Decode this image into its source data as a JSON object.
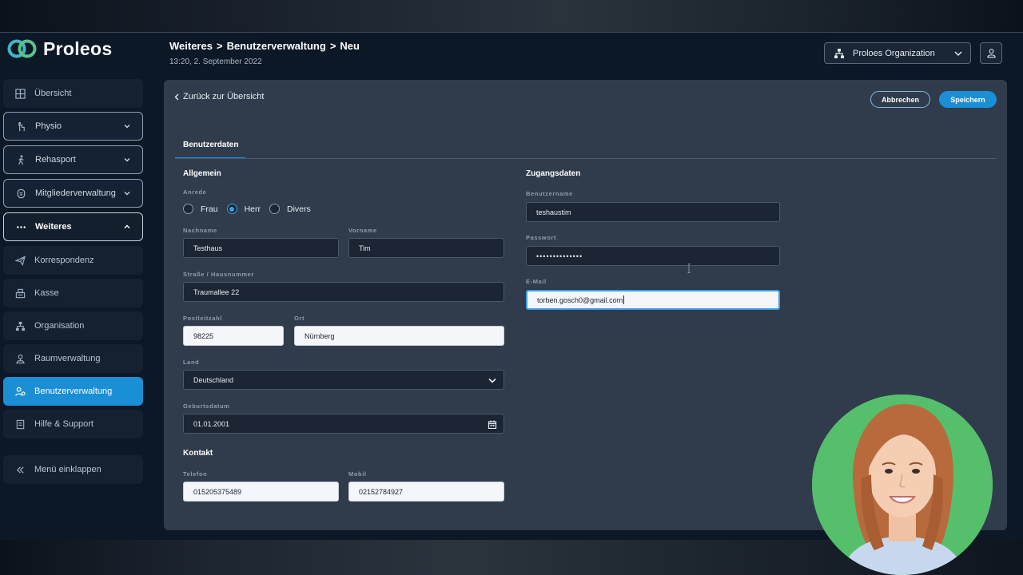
{
  "app": {
    "logo_text": "Proleos"
  },
  "header": {
    "breadcrumb": [
      "Weiteres",
      "Benutzerverwaltung",
      "Neu"
    ],
    "timestamp": "13:20, 2. September 2022",
    "org_select": "Proloes Organization"
  },
  "sidebar": {
    "items": [
      {
        "label": "Übersicht",
        "icon": "grid-icon"
      },
      {
        "label": "Physio",
        "icon": "physio-icon"
      },
      {
        "label": "Rehasport",
        "icon": "walking-icon"
      },
      {
        "label": "Mitgliederverwaltung",
        "icon": "member-icon"
      },
      {
        "label": "Weiteres",
        "icon": "more-icon"
      },
      {
        "label": "Korrespondenz",
        "icon": "send-icon"
      },
      {
        "label": "Kasse",
        "icon": "register-icon"
      },
      {
        "label": "Organisation",
        "icon": "org-icon"
      },
      {
        "label": "Raumverwaltung",
        "icon": "room-icon"
      },
      {
        "label": "Benutzerverwaltung",
        "icon": "user-settings-icon"
      },
      {
        "label": "Hilfe & Support",
        "icon": "help-icon"
      },
      {
        "label": "Menü einklappen",
        "icon": "collapse-icon"
      }
    ]
  },
  "panel": {
    "back_link": "Zurück zur Übersicht",
    "cancel_label": "Abbrechen",
    "save_label": "Speichern",
    "tab_label": "Benutzerdaten",
    "general": {
      "title": "Allgemein",
      "salutation_label": "Anrede",
      "salutation_options": [
        "Frau",
        "Herr",
        "Divers"
      ],
      "salutation_selected": "Herr",
      "lastname_label": "Nachname",
      "lastname_value": "Testhaus",
      "firstname_label": "Vorname",
      "firstname_value": "Tim",
      "street_label": "Straße / Hausnummer",
      "street_value": "Traumallee 22",
      "zip_label": "Postleitzahl",
      "zip_value": "98225",
      "city_label": "Ort",
      "city_value": "Nürnberg",
      "country_label": "Land",
      "country_value": "Deutschland",
      "birthday_label": "Geburtsdatum",
      "birthday_value": "01.01.2001"
    },
    "contact": {
      "title": "Kontakt",
      "phone_label": "Telefon",
      "phone_value": "015205375489",
      "mobile_label": "Mobil",
      "mobile_value": "02152784927"
    },
    "access": {
      "title": "Zugangsdaten",
      "username_label": "Benutzername",
      "username_value": "teshaustim",
      "password_label": "Passwort",
      "password_value": "••••••••••••••",
      "email_label": "E-Mail",
      "email_value": "torben.gosch0@gmail.com"
    }
  },
  "colors": {
    "accent": "#1a8fd6",
    "panel": "#303c4c",
    "background": "#0d1826"
  }
}
